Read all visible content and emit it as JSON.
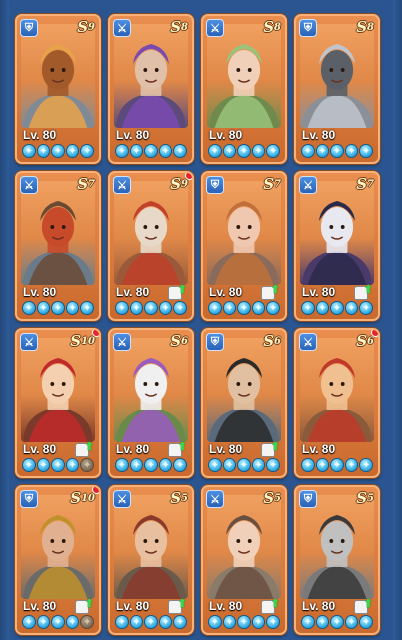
{
  "screen": {
    "background": "#2a5590",
    "card_color": "#e98e4e"
  },
  "heroes": [
    {
      "rank": "S",
      "tier": "9",
      "level": "Lv. 80",
      "class_icon": "shield-icon",
      "stars": 5,
      "dim_stars": 0,
      "upgrade": false,
      "alert": false,
      "palette": [
        "#7f8a96",
        "#e8a24a",
        "#a35a2a"
      ]
    },
    {
      "rank": "S",
      "tier": "8",
      "level": "Lv. 80",
      "class_icon": "sword-icon",
      "stars": 5,
      "dim_stars": 0,
      "upgrade": false,
      "alert": false,
      "palette": [
        "#5b4a7a",
        "#7a4ab0",
        "#e0c0a8"
      ]
    },
    {
      "rank": "S",
      "tier": "8",
      "level": "Lv. 80",
      "class_icon": "sword-icon",
      "stars": 5,
      "dim_stars": 0,
      "upgrade": false,
      "alert": false,
      "palette": [
        "#6f8a4c",
        "#9ac27a",
        "#f0d0b8"
      ]
    },
    {
      "rank": "S",
      "tier": "8",
      "level": "Lv. 80",
      "class_icon": "shield-icon",
      "stars": 5,
      "dim_stars": 0,
      "upgrade": false,
      "alert": false,
      "palette": [
        "#8a8f98",
        "#c0c4cc",
        "#5a5f68"
      ]
    },
    {
      "rank": "S",
      "tier": "7",
      "level": "Lv. 80",
      "class_icon": "sword-icon",
      "stars": 5,
      "dim_stars": 0,
      "upgrade": false,
      "alert": false,
      "palette": [
        "#6a7c8a",
        "#6b4a34",
        "#c74a2a"
      ]
    },
    {
      "rank": "S",
      "tier": "9",
      "level": "Lv. 80",
      "class_icon": "sword-icon",
      "stars": 5,
      "dim_stars": 0,
      "upgrade": true,
      "alert": true,
      "palette": [
        "#9a5a3a",
        "#c0402a",
        "#e8d8c8"
      ]
    },
    {
      "rank": "S",
      "tier": "7",
      "level": "Lv. 80",
      "class_icon": "shield-icon",
      "stars": 5,
      "dim_stars": 0,
      "upgrade": true,
      "alert": false,
      "palette": [
        "#8a6a5a",
        "#c0703a",
        "#f0c8b0"
      ]
    },
    {
      "rank": "S",
      "tier": "7",
      "level": "Lv. 80",
      "class_icon": "sword-icon",
      "stars": 5,
      "dim_stars": 0,
      "upgrade": true,
      "alert": false,
      "palette": [
        "#4a3a6a",
        "#2a2a4a",
        "#e8e8f0"
      ]
    },
    {
      "rank": "S",
      "tier": "10",
      "level": "Lv. 80",
      "class_icon": "sword-icon",
      "stars": 4,
      "dim_stars": 1,
      "upgrade": true,
      "alert": true,
      "palette": [
        "#7a3a2a",
        "#c02a2a",
        "#f4d0b0"
      ]
    },
    {
      "rank": "S",
      "tier": "6",
      "level": "Lv. 80",
      "class_icon": "sword-icon",
      "stars": 5,
      "dim_stars": 0,
      "upgrade": true,
      "alert": false,
      "palette": [
        "#6a8a4a",
        "#9a5ac0",
        "#f0f0f0"
      ]
    },
    {
      "rank": "S",
      "tier": "6",
      "level": "Lv. 80",
      "class_icon": "shield-icon",
      "stars": 5,
      "dim_stars": 0,
      "upgrade": true,
      "alert": false,
      "palette": [
        "#5a6a7a",
        "#2a2a2a",
        "#e0c0a0"
      ]
    },
    {
      "rank": "S",
      "tier": "6",
      "level": "Lv. 80",
      "class_icon": "sword-icon",
      "stars": 5,
      "dim_stars": 0,
      "upgrade": false,
      "alert": true,
      "palette": [
        "#8a5a3a",
        "#c03a2a",
        "#f0c090"
      ]
    },
    {
      "rank": "S",
      "tier": "10",
      "level": "Lv. 80",
      "class_icon": "shield-icon",
      "stars": 4,
      "dim_stars": 1,
      "upgrade": true,
      "alert": true,
      "palette": [
        "#6a6a6a",
        "#c0902a",
        "#e0b090"
      ]
    },
    {
      "rank": "S",
      "tier": "5",
      "level": "Lv. 80",
      "class_icon": "sword-icon",
      "stars": 5,
      "dim_stars": 0,
      "upgrade": true,
      "alert": false,
      "palette": [
        "#6a5a4a",
        "#8a3a2a",
        "#e8c0a0"
      ]
    },
    {
      "rank": "S",
      "tier": "5",
      "level": "Lv. 80",
      "class_icon": "sword-icon",
      "stars": 5,
      "dim_stars": 0,
      "upgrade": true,
      "alert": false,
      "palette": [
        "#8a7a6a",
        "#6a5040",
        "#f0d0b8"
      ]
    },
    {
      "rank": "S",
      "tier": "5",
      "level": "Lv. 80",
      "class_icon": "shield-icon",
      "stars": 5,
      "dim_stars": 0,
      "upgrade": true,
      "alert": false,
      "palette": [
        "#7a7a7a",
        "#3a3a3a",
        "#c0c0c0"
      ]
    }
  ]
}
